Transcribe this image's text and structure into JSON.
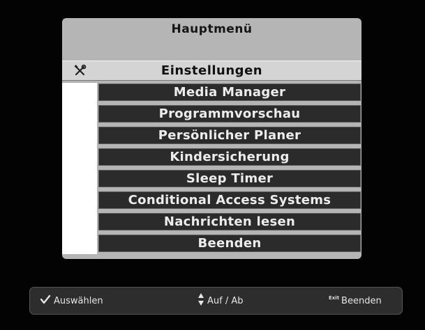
{
  "menu": {
    "title": "Hauptmenü",
    "selected": {
      "label": "Einstellungen",
      "icon": "tools-icon"
    },
    "items": [
      "Media Manager",
      "Programmvorschau",
      "Persönlicher Planer",
      "Kindersicherung",
      "Sleep Timer",
      "Conditional Access Systems",
      "Nachrichten lesen",
      "Beenden"
    ]
  },
  "footer": {
    "select_label": "Auswählen",
    "select_icon": "checkmark-icon",
    "nav_label": "Auf / Ab",
    "nav_icon": "up-down-arrows-icon",
    "exit_key": "Exit",
    "exit_label": "Beenden"
  },
  "colors": {
    "background": "#030303",
    "panel": "#b5b5b5",
    "selected_row": "#d4d4d4",
    "item": "#2b2b2b",
    "item_text": "#ececec"
  }
}
